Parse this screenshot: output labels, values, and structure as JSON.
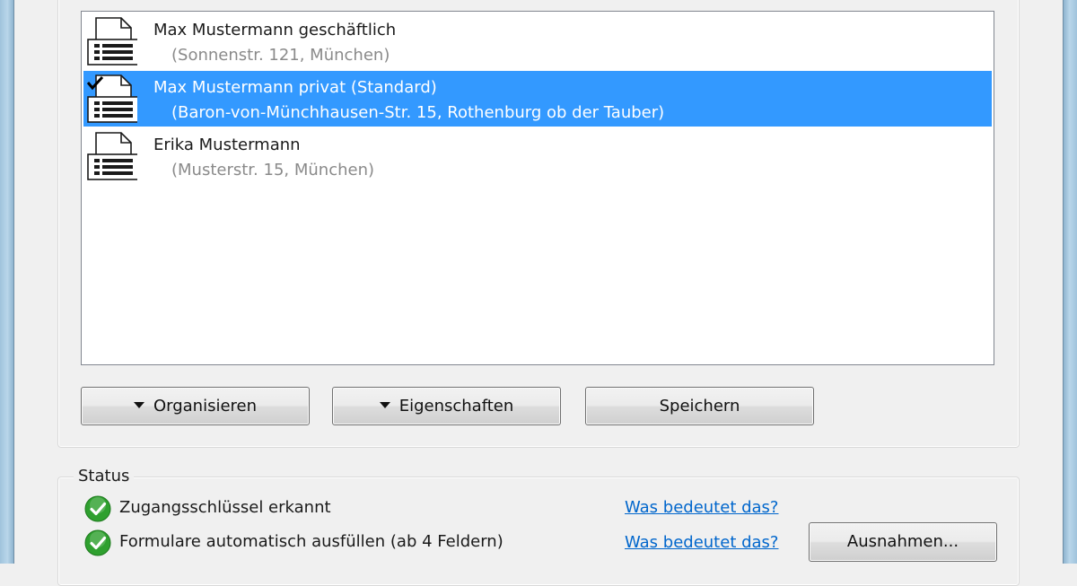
{
  "profiles": [
    {
      "name": "Max Mustermann geschäftlich",
      "address": "(Sonnenstr. 121, München)",
      "selected": false,
      "default": false
    },
    {
      "name": "Max Mustermann privat (Standard)",
      "address": "(Baron-von-Münchhausen-Str. 15, Rothenburg ob der Tauber)",
      "selected": true,
      "default": true
    },
    {
      "name": "Erika Mustermann",
      "address": "(Musterstr. 15, München)",
      "selected": false,
      "default": false
    }
  ],
  "buttons": {
    "organize": "Organisieren",
    "properties": "Eigenschaften",
    "save": "Speichern",
    "exceptions": "Ausnahmen..."
  },
  "status": {
    "title": "Status",
    "items": [
      {
        "label": "Zugangsschlüssel erkannt",
        "link": "Was bedeutet das?"
      },
      {
        "label": "Formulare automatisch ausfüllen (ab 4 Feldern)",
        "link": "Was bedeutet das?"
      }
    ]
  },
  "icons": {
    "profile": "profile-card-icon",
    "default_marker": "checkmark-icon",
    "status_ok": "green-check-circle-icon",
    "dropdown": "triangle-down-icon"
  },
  "colors": {
    "selection": "#3399ff",
    "link": "#0066cc",
    "status_ok": "#2fa02f",
    "address_gray": "#8a8a8a"
  }
}
